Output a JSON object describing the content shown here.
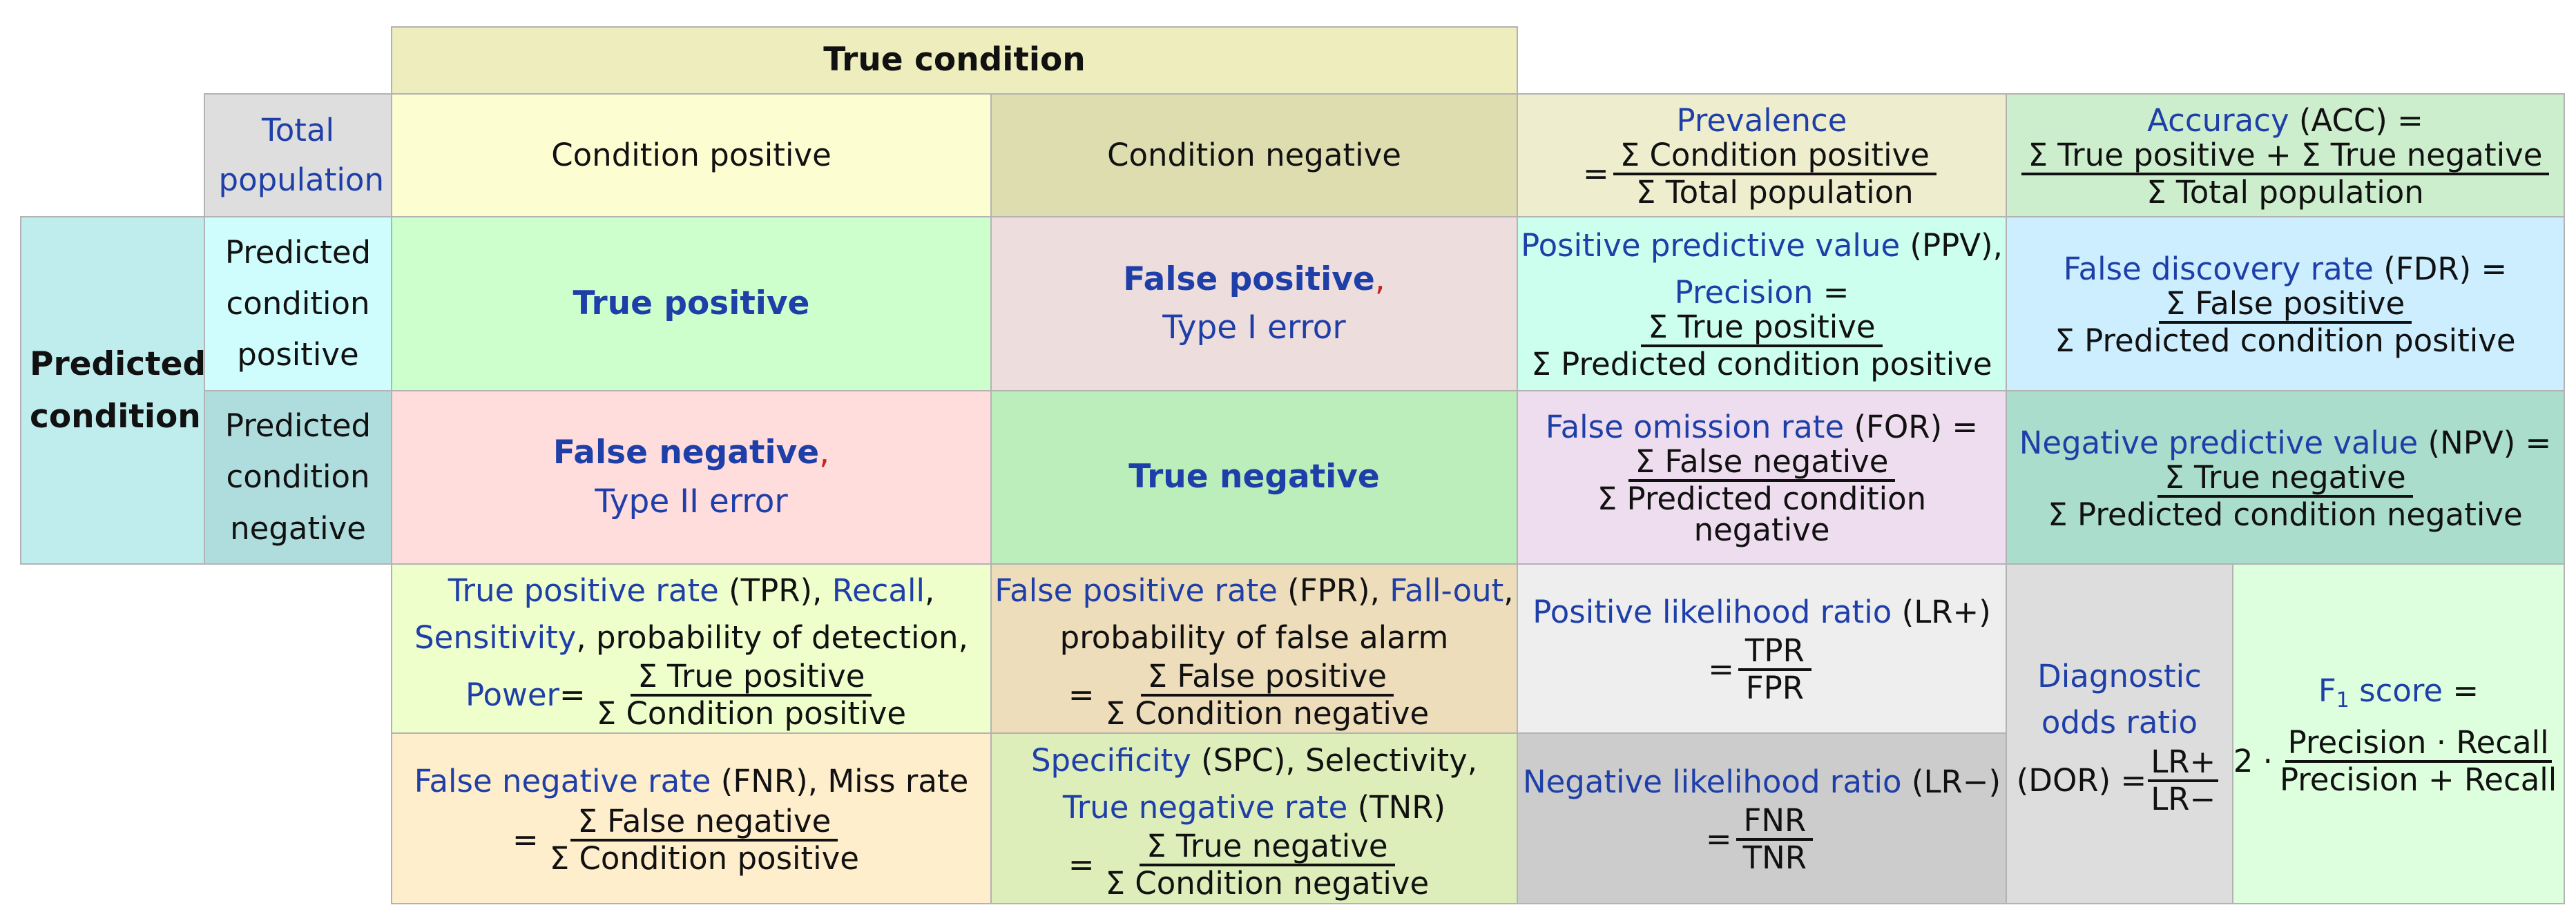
{
  "header": {
    "true_condition": "True condition",
    "total_population": "Total population",
    "predicted_condition": "Predicted condition"
  },
  "columns": {
    "condition_positive": "Condition positive",
    "condition_negative": "Condition negative"
  },
  "rows": {
    "predicted_positive": "Predicted condition positive",
    "predicted_negative": "Predicted condition negative"
  },
  "cells": {
    "true_positive": "True positive",
    "false_positive": "False positive",
    "type_one_error": "Type I error",
    "false_negative": "False negative",
    "type_two_error": "Type II error",
    "true_negative": "True negative",
    "comma": ","
  },
  "prevalence": {
    "label": "Prevalence",
    "eq": "=",
    "num": "Σ Condition positive",
    "den": "Σ Total population"
  },
  "accuracy": {
    "label": "Accuracy",
    "abbr": " (ACC) =",
    "num": "Σ True positive + Σ True negative",
    "den": "Σ Total population"
  },
  "ppv": {
    "label": "Positive predictive value",
    "abbr": " (PPV),",
    "alt": "Precision",
    "eq": " =",
    "num": "Σ True positive",
    "den": "Σ Predicted condition positive"
  },
  "fdr": {
    "label": "False discovery rate",
    "abbr": " (FDR) =",
    "num": "Σ False positive",
    "den": "Σ Predicted condition positive"
  },
  "for_rate": {
    "label": "False omission rate",
    "abbr": " (FOR) =",
    "num": "Σ False negative",
    "den": "Σ Predicted condition negative"
  },
  "npv": {
    "label": "Negative predictive value",
    "abbr": " (NPV) =",
    "num": "Σ True negative",
    "den": "Σ Predicted condition negative"
  },
  "tpr": {
    "label": "True positive rate",
    "abbr": " (TPR), ",
    "recall": "Recall",
    "comma": ",",
    "sensitivity": "Sensitivity",
    "detection": ", probability of detection,",
    "power": "Power",
    "eq": " =",
    "num": "Σ True positive",
    "den": "Σ Condition positive"
  },
  "fpr": {
    "label": "False positive rate",
    "abbr": " (FPR), ",
    "fallout": "Fall-out",
    "comma": ",",
    "alarm": "probability of false alarm",
    "eq": "=",
    "num": "Σ False positive",
    "den": "Σ Condition negative"
  },
  "fnr": {
    "label": "False negative rate",
    "abbr": " (FNR), Miss rate",
    "eq": "=",
    "num": "Σ False negative",
    "den": "Σ Condition positive"
  },
  "spc": {
    "label": "Specificity",
    "abbr": " (SPC), Selectivity,",
    "tnr": "True negative rate",
    "tnr_abbr": " (TNR)",
    "eq": "=",
    "num": "Σ True negative",
    "den": "Σ Condition negative"
  },
  "lr_pos": {
    "label": "Positive likelihood ratio",
    "abbr": " (LR+)",
    "eq": "=",
    "num": "TPR",
    "den": "FPR"
  },
  "lr_neg": {
    "label": "Negative likelihood ratio",
    "abbr": " (LR−)",
    "eq": "=",
    "num": "FNR",
    "den": "TNR"
  },
  "dor": {
    "line1": "Diagnostic",
    "line2": "odds ratio",
    "abbr": "(DOR) =",
    "num": "LR+",
    "den": "LR−"
  },
  "f1": {
    "f": "F",
    "sub": "1",
    "label": " score",
    "eq": " =",
    "coef": "2 ·",
    "num": "Precision · Recall",
    "den": "Precision + Recall"
  },
  "colors": {
    "true_condition_bg": "#ededbd",
    "condition_positive_bg": "#fdfdd2",
    "condition_negative_bg": "#ddddaf",
    "total_population_bg": "#dedede",
    "predicted_condition_bg": "#bfeded",
    "predicted_positive_bg": "#cffcfc",
    "predicted_negative_bg": "#afdddd",
    "true_positive_bg": "#ccffcc",
    "false_positive_bg": "#eedddd",
    "false_negative_bg": "#ffdddd",
    "true_negative_bg": "#bbeebb",
    "prevalence_bg": "#eeeecf",
    "accuracy_bg": "#cceecc",
    "ppv_bg": "#ccffee",
    "fdr_bg": "#cceeff",
    "for_bg": "#eeddee",
    "npv_bg": "#aaddcc",
    "tpr_bg": "#eeffcc",
    "fpr_bg": "#eeddbb",
    "fnr_bg": "#ffeecc",
    "spc_bg": "#ddeebb",
    "lr_pos_bg": "#eeeeee",
    "lr_neg_bg": "#cccccc",
    "dor_bg": "#dddddd",
    "f1_bg": "#ddffdd",
    "label_blue": "#1f3fa8",
    "comma_red": "#cc1f1f"
  }
}
